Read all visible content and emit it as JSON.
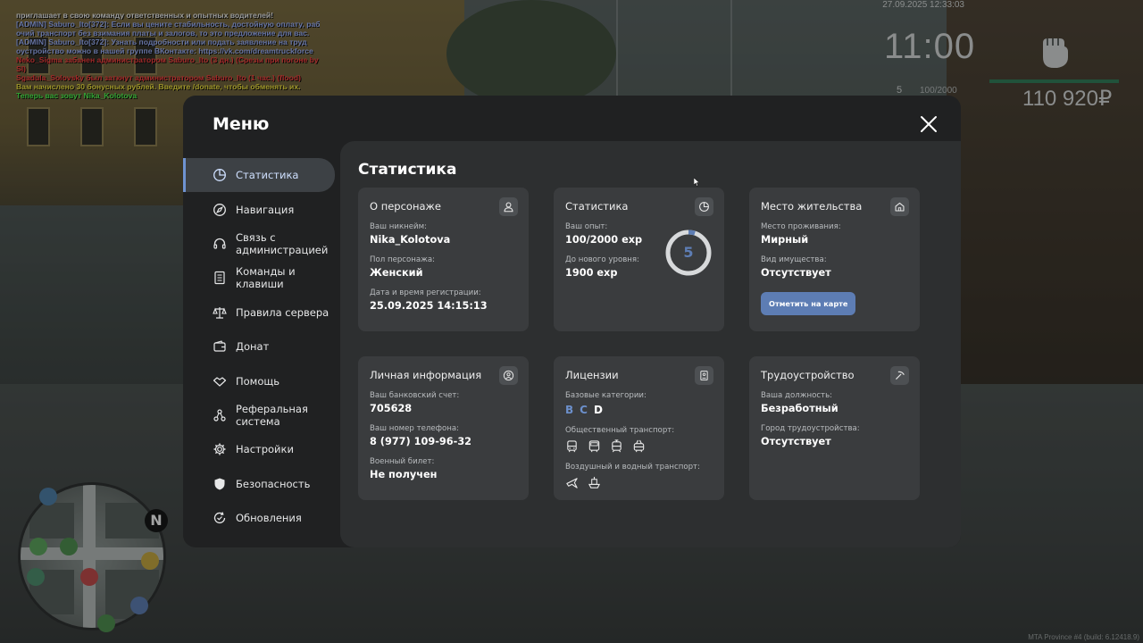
{
  "chat": [
    {
      "color": "white",
      "text": "приглашает в свою команду ответственных и опытных водителей!"
    },
    {
      "color": "blue",
      "text": "[ADMIN] Saburo_Ito[372]: Если вы цените стабильность, достойную оплату, раб"
    },
    {
      "color": "blue",
      "text": "очий транспорт без взимания платы и залогов, то это предложение для вас."
    },
    {
      "color": "blue",
      "text": "[ADMIN] Saburo_Ito[372]: Узнать подробности или подать заявление на труд"
    },
    {
      "color": "blue",
      "text": "оустройство можно в нашей группе ВКонтакте: https://vk.com/dreamtruckforce"
    },
    {
      "color": "red",
      "text": "Neko_Sigma забанен администратором Saburo_Ito (3 дн.) (Срезы при погоне by"
    },
    {
      "color": "red",
      "text": " SI)"
    },
    {
      "color": "red",
      "text": "Sgadula_Solovsky был заткнут администратором Saburo_Ito (1 час.) (flood)"
    },
    {
      "color": "yellow",
      "text": "Вам начислено 30 бонусных рублей. Введите /donate, чтобы обменять их."
    },
    {
      "color": "green",
      "text": "Теперь вас зовут Nika_Kolotova"
    }
  ],
  "hud": {
    "datetime": "27.09.2025 12:33:03",
    "clock": "11:00",
    "level": "5",
    "exp": "100/2000",
    "money": "110 920₽",
    "health_fraction": 1.0,
    "watermark": "MTA Province #4 (build: 6.12418.9)"
  },
  "minimap": {
    "north": "N"
  },
  "menu": {
    "title": "Меню",
    "nav": [
      {
        "label": "Статистика",
        "icon": "chart-pie-icon",
        "active": true
      },
      {
        "label": "Навигация",
        "icon": "compass-icon",
        "active": false
      },
      {
        "label": "Связь с администрацией",
        "icon": "headset-icon",
        "active": false
      },
      {
        "label": "Команды и клавиши",
        "icon": "document-icon",
        "active": false
      },
      {
        "label": "Правила сервера",
        "icon": "scales-icon",
        "active": false
      },
      {
        "label": "Донат",
        "icon": "wallet-icon",
        "active": false
      },
      {
        "label": "Помощь",
        "icon": "handshake-icon",
        "active": false
      },
      {
        "label": "Реферальная система",
        "icon": "network-icon",
        "active": false
      },
      {
        "label": "Настройки",
        "icon": "gear-icon",
        "active": false
      },
      {
        "label": "Безопасность",
        "icon": "shield-icon",
        "active": false
      },
      {
        "label": "Обновления",
        "icon": "refresh-check-icon",
        "active": false
      }
    ],
    "content_title": "Статистика",
    "cards": {
      "character": {
        "title": "О персонаже",
        "nickname_label": "Ваш никнейм:",
        "nickname": "Nika_Kolotova",
        "gender_label": "Пол персонажа:",
        "gender": "Женский",
        "reg_label": "Дата и время регистрации:",
        "reg": "25.09.2025 14:15:13"
      },
      "stats": {
        "title": "Статистика",
        "exp_label": "Ваш опыт:",
        "exp": "100/2000 exp",
        "next_label": "До нового уровня:",
        "next": "1900 exp",
        "level": "5",
        "progress": 0.05
      },
      "residence": {
        "title": "Место жительства",
        "place_label": "Место проживания:",
        "place": "Мирный",
        "property_label": "Вид имущества:",
        "property": "Отсутствует",
        "button": "Отметить на карте"
      },
      "personal": {
        "title": "Личная информация",
        "bank_label": "Ваш банковский счет:",
        "bank": "705628",
        "phone_label": "Ваш номер телефона:",
        "phone": "8 (977) 109-96-32",
        "military_label": "Военный билет:",
        "military": "Не получен"
      },
      "licenses": {
        "title": "Лицензии",
        "base_label": "Базовые категории:",
        "categories": [
          {
            "letter": "B",
            "active": true
          },
          {
            "letter": "C",
            "active": true
          },
          {
            "letter": "D",
            "active": false
          }
        ],
        "public_label": "Общественный транспорт:",
        "public_icons": [
          "bus-icon",
          "coach-icon",
          "tram-icon",
          "trolleybus-icon"
        ],
        "air_label": "Воздушный и водный транспорт:",
        "air_icons": [
          "plane-icon",
          "boat-icon"
        ]
      },
      "job": {
        "title": "Трудоустройство",
        "position_label": "Ваша должность:",
        "position": "Безработный",
        "city_label": "Город трудоустройства:",
        "city": "Отсутствует"
      }
    }
  }
}
